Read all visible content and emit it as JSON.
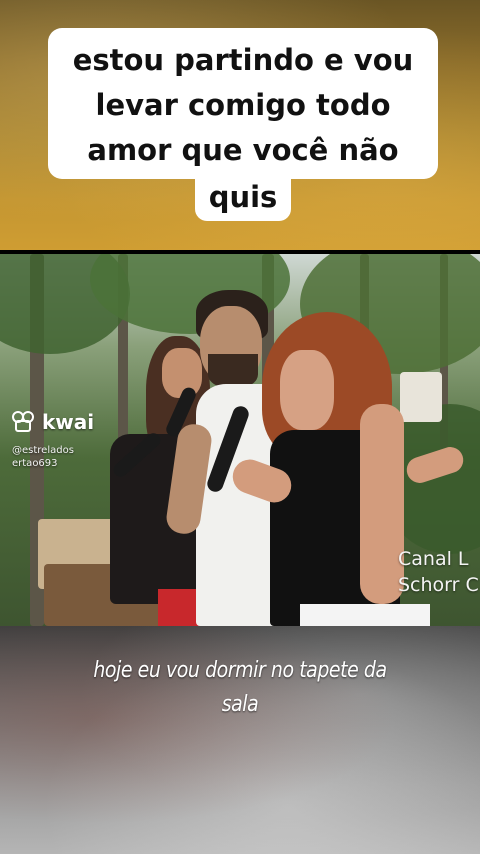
{
  "top_caption": {
    "lines": [
      "estou partindo e vou",
      "levar comigo todo",
      "amor que você não"
    ],
    "tail": "quis"
  },
  "video": {
    "platform_logo": "kwai",
    "platform_handle": "@estreladosertao693",
    "watermark_line1": "Canal L",
    "watermark_line2": "Schorr C",
    "logo_icon": "kwai-logo-icon"
  },
  "subtitle": {
    "line1": "hoje eu vou dormir no tapete da",
    "line2": "sala"
  },
  "colors": {
    "banner_gold": "#c49631",
    "caption_bg": "#ffffff",
    "skirt_red": "#c8282c"
  }
}
